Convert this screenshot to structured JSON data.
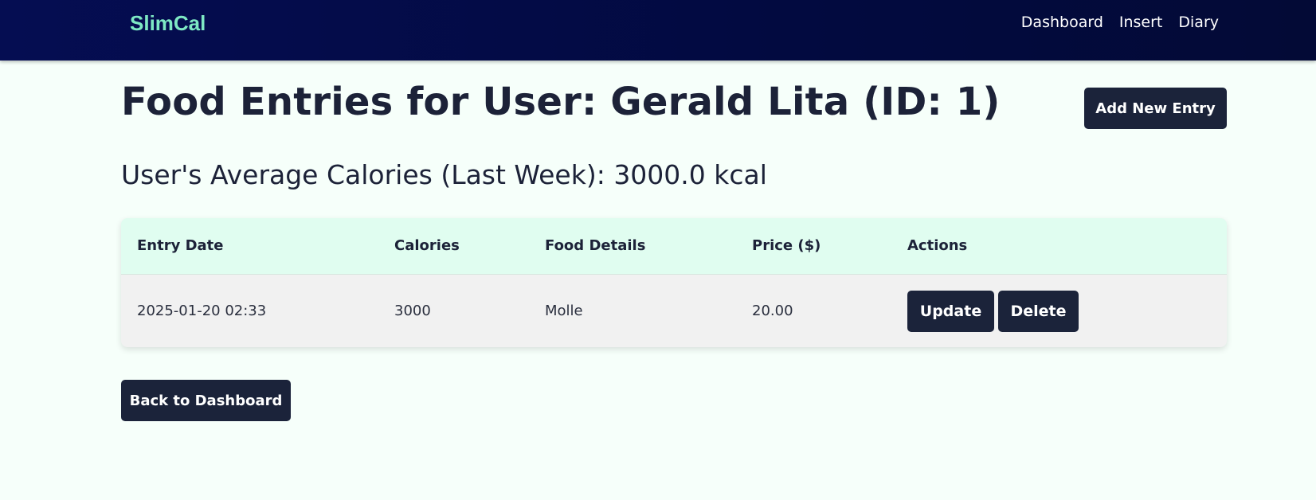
{
  "navbar": {
    "brand": "SlimCal",
    "links": [
      "Dashboard",
      "Insert",
      "Diary"
    ]
  },
  "page": {
    "title": "Food Entries for User: Gerald Lita (ID: 1)",
    "add_button": "Add New Entry",
    "average_heading": "User's Average Calories (Last Week): 3000.0 kcal",
    "back_button": "Back to Dashboard"
  },
  "table": {
    "headers": [
      "Entry Date",
      "Calories",
      "Food Details",
      "Price ($)",
      "Actions"
    ],
    "rows": [
      {
        "entry_date": "2025-01-20 02:33",
        "calories": "3000",
        "food_details": "Molle",
        "price": "20.00",
        "update_label": "Update",
        "delete_label": "Delete"
      }
    ]
  },
  "colors": {
    "navbar_bg": "#030b45",
    "brand": "#7ee8c4",
    "button_bg": "#1b233a",
    "table_header_bg": "#e0fdf0",
    "page_bg": "#f6fffa"
  }
}
